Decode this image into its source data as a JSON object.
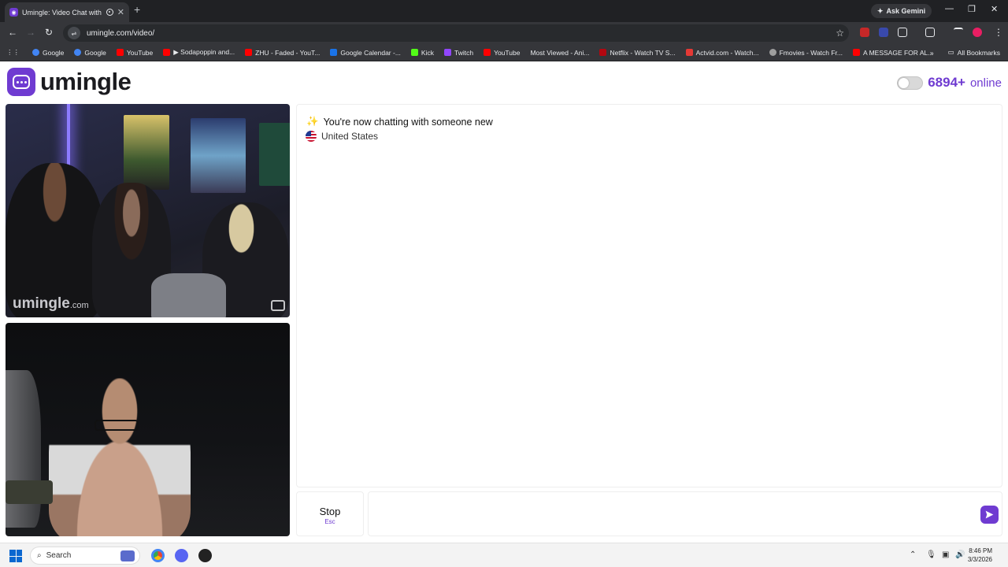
{
  "browser": {
    "tab_title": "Umingle: Video Chat with S",
    "url": "umingle.com/video/",
    "ask_gemini": "Ask Gemini",
    "bookmarks": [
      {
        "label": "Google",
        "color": "#4285f4"
      },
      {
        "label": "Google",
        "color": "#4285f4"
      },
      {
        "label": "YouTube",
        "color": "#ff0000"
      },
      {
        "label": "▶ Sodapoppin and...",
        "color": "#ff0000"
      },
      {
        "label": "ZHU - Faded - YouT...",
        "color": "#ff0000"
      },
      {
        "label": "Google Calendar -...",
        "color": "#1a73e8"
      },
      {
        "label": "Kick",
        "color": "#53fc18"
      },
      {
        "label": "Twitch",
        "color": "#9146ff"
      },
      {
        "label": "YouTube",
        "color": "#ff0000"
      },
      {
        "label": "Most Viewed - Ani...",
        "color": "#35363a"
      },
      {
        "label": "Netflix - Watch TV S...",
        "color": "#b20710"
      },
      {
        "label": "Actvid.com - Watch...",
        "color": "#e53935"
      },
      {
        "label": "Fmovies - Watch Fr...",
        "color": "#9e9e9e"
      },
      {
        "label": "A MESSAGE FOR AL...",
        "color": "#ff0000"
      }
    ],
    "all_bookmarks": "All Bookmarks"
  },
  "header": {
    "logo_text": "umingle",
    "online_count": "6894+",
    "online_label": "online"
  },
  "video": {
    "watermark": "umingle",
    "watermark_suffix": ".com"
  },
  "chat": {
    "status_emoji": "✨",
    "status_message": "You're now chatting with someone new",
    "country": "United States"
  },
  "controls": {
    "stop_label": "Stop",
    "stop_hint": "Esc",
    "message_placeholder": ""
  },
  "taskbar": {
    "search_label": "Search",
    "time": "8:46 PM",
    "date": "3/3/2026"
  },
  "colors": {
    "brand": "#6f3bd1"
  }
}
